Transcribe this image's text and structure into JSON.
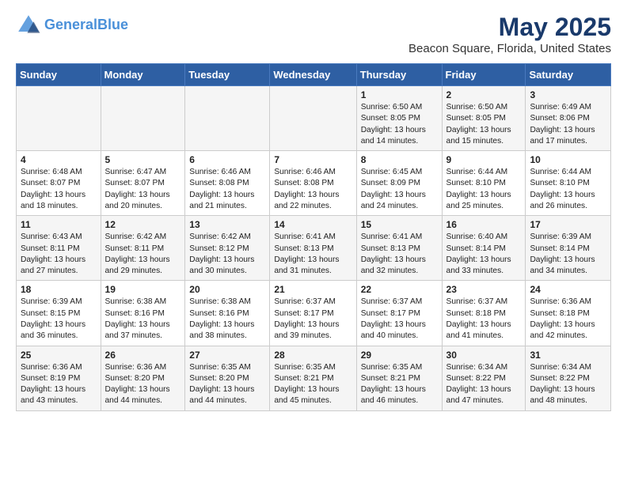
{
  "header": {
    "logo_line1": "General",
    "logo_line2": "Blue",
    "month_year": "May 2025",
    "location": "Beacon Square, Florida, United States"
  },
  "days_of_week": [
    "Sunday",
    "Monday",
    "Tuesday",
    "Wednesday",
    "Thursday",
    "Friday",
    "Saturday"
  ],
  "weeks": [
    [
      {
        "num": "",
        "info": ""
      },
      {
        "num": "",
        "info": ""
      },
      {
        "num": "",
        "info": ""
      },
      {
        "num": "",
        "info": ""
      },
      {
        "num": "1",
        "info": "Sunrise: 6:50 AM\nSunset: 8:05 PM\nDaylight: 13 hours\nand 14 minutes."
      },
      {
        "num": "2",
        "info": "Sunrise: 6:50 AM\nSunset: 8:05 PM\nDaylight: 13 hours\nand 15 minutes."
      },
      {
        "num": "3",
        "info": "Sunrise: 6:49 AM\nSunset: 8:06 PM\nDaylight: 13 hours\nand 17 minutes."
      }
    ],
    [
      {
        "num": "4",
        "info": "Sunrise: 6:48 AM\nSunset: 8:07 PM\nDaylight: 13 hours\nand 18 minutes."
      },
      {
        "num": "5",
        "info": "Sunrise: 6:47 AM\nSunset: 8:07 PM\nDaylight: 13 hours\nand 20 minutes."
      },
      {
        "num": "6",
        "info": "Sunrise: 6:46 AM\nSunset: 8:08 PM\nDaylight: 13 hours\nand 21 minutes."
      },
      {
        "num": "7",
        "info": "Sunrise: 6:46 AM\nSunset: 8:08 PM\nDaylight: 13 hours\nand 22 minutes."
      },
      {
        "num": "8",
        "info": "Sunrise: 6:45 AM\nSunset: 8:09 PM\nDaylight: 13 hours\nand 24 minutes."
      },
      {
        "num": "9",
        "info": "Sunrise: 6:44 AM\nSunset: 8:10 PM\nDaylight: 13 hours\nand 25 minutes."
      },
      {
        "num": "10",
        "info": "Sunrise: 6:44 AM\nSunset: 8:10 PM\nDaylight: 13 hours\nand 26 minutes."
      }
    ],
    [
      {
        "num": "11",
        "info": "Sunrise: 6:43 AM\nSunset: 8:11 PM\nDaylight: 13 hours\nand 27 minutes."
      },
      {
        "num": "12",
        "info": "Sunrise: 6:42 AM\nSunset: 8:11 PM\nDaylight: 13 hours\nand 29 minutes."
      },
      {
        "num": "13",
        "info": "Sunrise: 6:42 AM\nSunset: 8:12 PM\nDaylight: 13 hours\nand 30 minutes."
      },
      {
        "num": "14",
        "info": "Sunrise: 6:41 AM\nSunset: 8:13 PM\nDaylight: 13 hours\nand 31 minutes."
      },
      {
        "num": "15",
        "info": "Sunrise: 6:41 AM\nSunset: 8:13 PM\nDaylight: 13 hours\nand 32 minutes."
      },
      {
        "num": "16",
        "info": "Sunrise: 6:40 AM\nSunset: 8:14 PM\nDaylight: 13 hours\nand 33 minutes."
      },
      {
        "num": "17",
        "info": "Sunrise: 6:39 AM\nSunset: 8:14 PM\nDaylight: 13 hours\nand 34 minutes."
      }
    ],
    [
      {
        "num": "18",
        "info": "Sunrise: 6:39 AM\nSunset: 8:15 PM\nDaylight: 13 hours\nand 36 minutes."
      },
      {
        "num": "19",
        "info": "Sunrise: 6:38 AM\nSunset: 8:16 PM\nDaylight: 13 hours\nand 37 minutes."
      },
      {
        "num": "20",
        "info": "Sunrise: 6:38 AM\nSunset: 8:16 PM\nDaylight: 13 hours\nand 38 minutes."
      },
      {
        "num": "21",
        "info": "Sunrise: 6:37 AM\nSunset: 8:17 PM\nDaylight: 13 hours\nand 39 minutes."
      },
      {
        "num": "22",
        "info": "Sunrise: 6:37 AM\nSunset: 8:17 PM\nDaylight: 13 hours\nand 40 minutes."
      },
      {
        "num": "23",
        "info": "Sunrise: 6:37 AM\nSunset: 8:18 PM\nDaylight: 13 hours\nand 41 minutes."
      },
      {
        "num": "24",
        "info": "Sunrise: 6:36 AM\nSunset: 8:18 PM\nDaylight: 13 hours\nand 42 minutes."
      }
    ],
    [
      {
        "num": "25",
        "info": "Sunrise: 6:36 AM\nSunset: 8:19 PM\nDaylight: 13 hours\nand 43 minutes."
      },
      {
        "num": "26",
        "info": "Sunrise: 6:36 AM\nSunset: 8:20 PM\nDaylight: 13 hours\nand 44 minutes."
      },
      {
        "num": "27",
        "info": "Sunrise: 6:35 AM\nSunset: 8:20 PM\nDaylight: 13 hours\nand 44 minutes."
      },
      {
        "num": "28",
        "info": "Sunrise: 6:35 AM\nSunset: 8:21 PM\nDaylight: 13 hours\nand 45 minutes."
      },
      {
        "num": "29",
        "info": "Sunrise: 6:35 AM\nSunset: 8:21 PM\nDaylight: 13 hours\nand 46 minutes."
      },
      {
        "num": "30",
        "info": "Sunrise: 6:34 AM\nSunset: 8:22 PM\nDaylight: 13 hours\nand 47 minutes."
      },
      {
        "num": "31",
        "info": "Sunrise: 6:34 AM\nSunset: 8:22 PM\nDaylight: 13 hours\nand 48 minutes."
      }
    ]
  ]
}
